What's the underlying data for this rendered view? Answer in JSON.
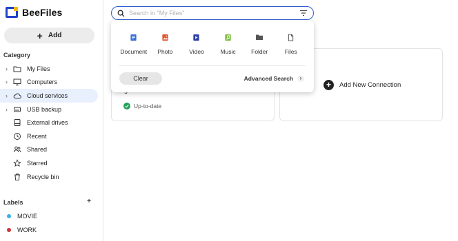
{
  "app": {
    "name": "BeeFiles"
  },
  "sidebar": {
    "add_label": "Add",
    "category_title": "Category",
    "items": [
      {
        "label": "My Files",
        "icon": "folder-icon",
        "chevron": true
      },
      {
        "label": "Computers",
        "icon": "monitor-icon",
        "chevron": true
      },
      {
        "label": "Cloud services",
        "icon": "cloud-icon",
        "chevron": true,
        "active": true
      },
      {
        "label": "USB backup",
        "icon": "usb-drive-icon",
        "chevron": true
      },
      {
        "label": "External drives",
        "icon": "hard-drive-icon",
        "chevron": false
      },
      {
        "label": "Recent",
        "icon": "clock-icon",
        "chevron": false
      },
      {
        "label": "Shared",
        "icon": "users-icon",
        "chevron": false
      },
      {
        "label": "Starred",
        "icon": "star-icon",
        "chevron": false
      },
      {
        "label": "Recycle bin",
        "icon": "trash-icon",
        "chevron": false
      }
    ],
    "labels_title": "Labels",
    "labels": [
      {
        "label": "MOVIE",
        "color": "#3ab0e6"
      },
      {
        "label": "WORK",
        "color": "#d2363a"
      }
    ]
  },
  "search": {
    "placeholder": "Search in \"My Files\"",
    "value": ""
  },
  "dropdown": {
    "types": [
      {
        "label": "Document",
        "icon": "document-icon",
        "color": "#3b6fd8"
      },
      {
        "label": "Photo",
        "icon": "photo-icon",
        "color": "#e0532f"
      },
      {
        "label": "Video",
        "icon": "video-icon",
        "color": "#2d3fa8"
      },
      {
        "label": "Music",
        "icon": "music-icon",
        "color": "#7cba3a"
      },
      {
        "label": "Folder",
        "icon": "folder-icon",
        "color": "#555555"
      },
      {
        "label": "Files",
        "icon": "file-icon",
        "color": "#444444"
      }
    ],
    "clear_label": "Clear",
    "advanced_label": "Advanced Search"
  },
  "main": {
    "card_stub_text": "g",
    "status_text": "Up-to-date",
    "add_connection_label": "Add New Connection"
  }
}
